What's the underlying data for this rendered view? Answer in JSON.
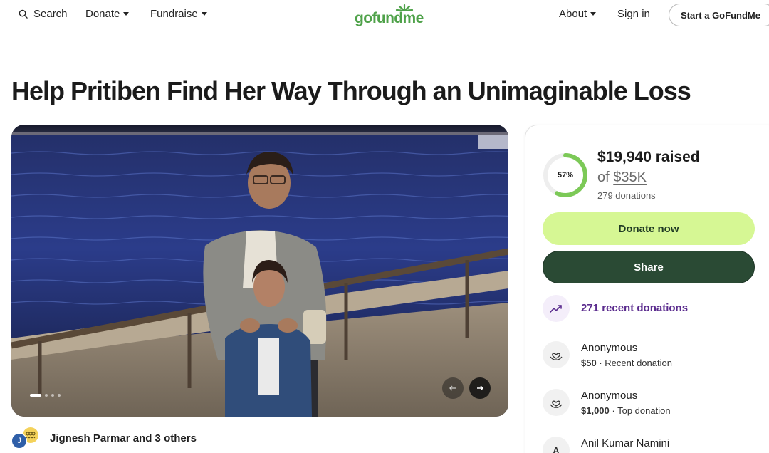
{
  "nav": {
    "search_label": "Search",
    "donate_label": "Donate",
    "fundraise_label": "Fundraise",
    "logo_text": "gofundme",
    "about_label": "About",
    "signin_label": "Sign in",
    "start_label": "Start a GoFundMe"
  },
  "campaign": {
    "title": "Help Pritiben Find Her Way Through an Unimaginable Loss",
    "organizer": "Jignesh Parmar and 3 others",
    "organizer_initial": "J",
    "carousel": {
      "slide_count": 4,
      "active_slide": 1
    }
  },
  "progress": {
    "percent_label": "57%",
    "percent_value": 57,
    "raised": "$19,940 raised",
    "goal_prefix": "of",
    "goal_amount": "$35K",
    "donations": "279 donations"
  },
  "actions": {
    "donate_label": "Donate now",
    "share_label": "Share"
  },
  "activity": {
    "recent_label": "271 recent donations",
    "donors": [
      {
        "name": "Anonymous",
        "amount": "$50",
        "type": "Recent donation"
      },
      {
        "name": "Anonymous",
        "amount": "$1,000",
        "type": "Top donation"
      },
      {
        "name": "Anil Kumar Namini",
        "initial": "A"
      }
    ]
  },
  "colors": {
    "brand_green": "#4fa24a",
    "donate_button": "#d6f794",
    "share_button": "#2a4a34",
    "progress_ring": "#7cc957",
    "recent_purple": "#5b2c8e"
  }
}
